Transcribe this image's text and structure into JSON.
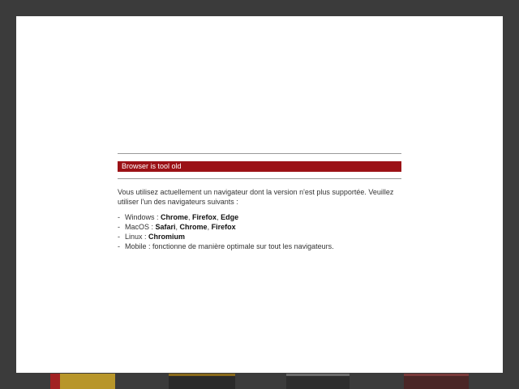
{
  "dialog": {
    "title": "Browser is tool old",
    "message": "Vous utilisez actuellement un navigateur dont la version n'est plus supportée. Veuillez utiliser l'un des navigateurs suivants :",
    "dash": "-",
    "separator": ", ",
    "platforms": [
      {
        "label": "Windows : ",
        "browsers": [
          "Chrome",
          "Firefox",
          "Edge"
        ]
      },
      {
        "label": "MacOS : ",
        "browsers": [
          "Safari",
          "Chrome",
          "Firefox"
        ]
      },
      {
        "label": "Linux : ",
        "browsers": [
          "Chromium"
        ]
      },
      {
        "label": "Mobile : fonctionne de manière optimale sur tout les navigateurs.",
        "browsers": []
      }
    ]
  },
  "colors": {
    "banner": "#9b1116",
    "overlay": "#3b3b3b",
    "modal": "#ffffff"
  }
}
